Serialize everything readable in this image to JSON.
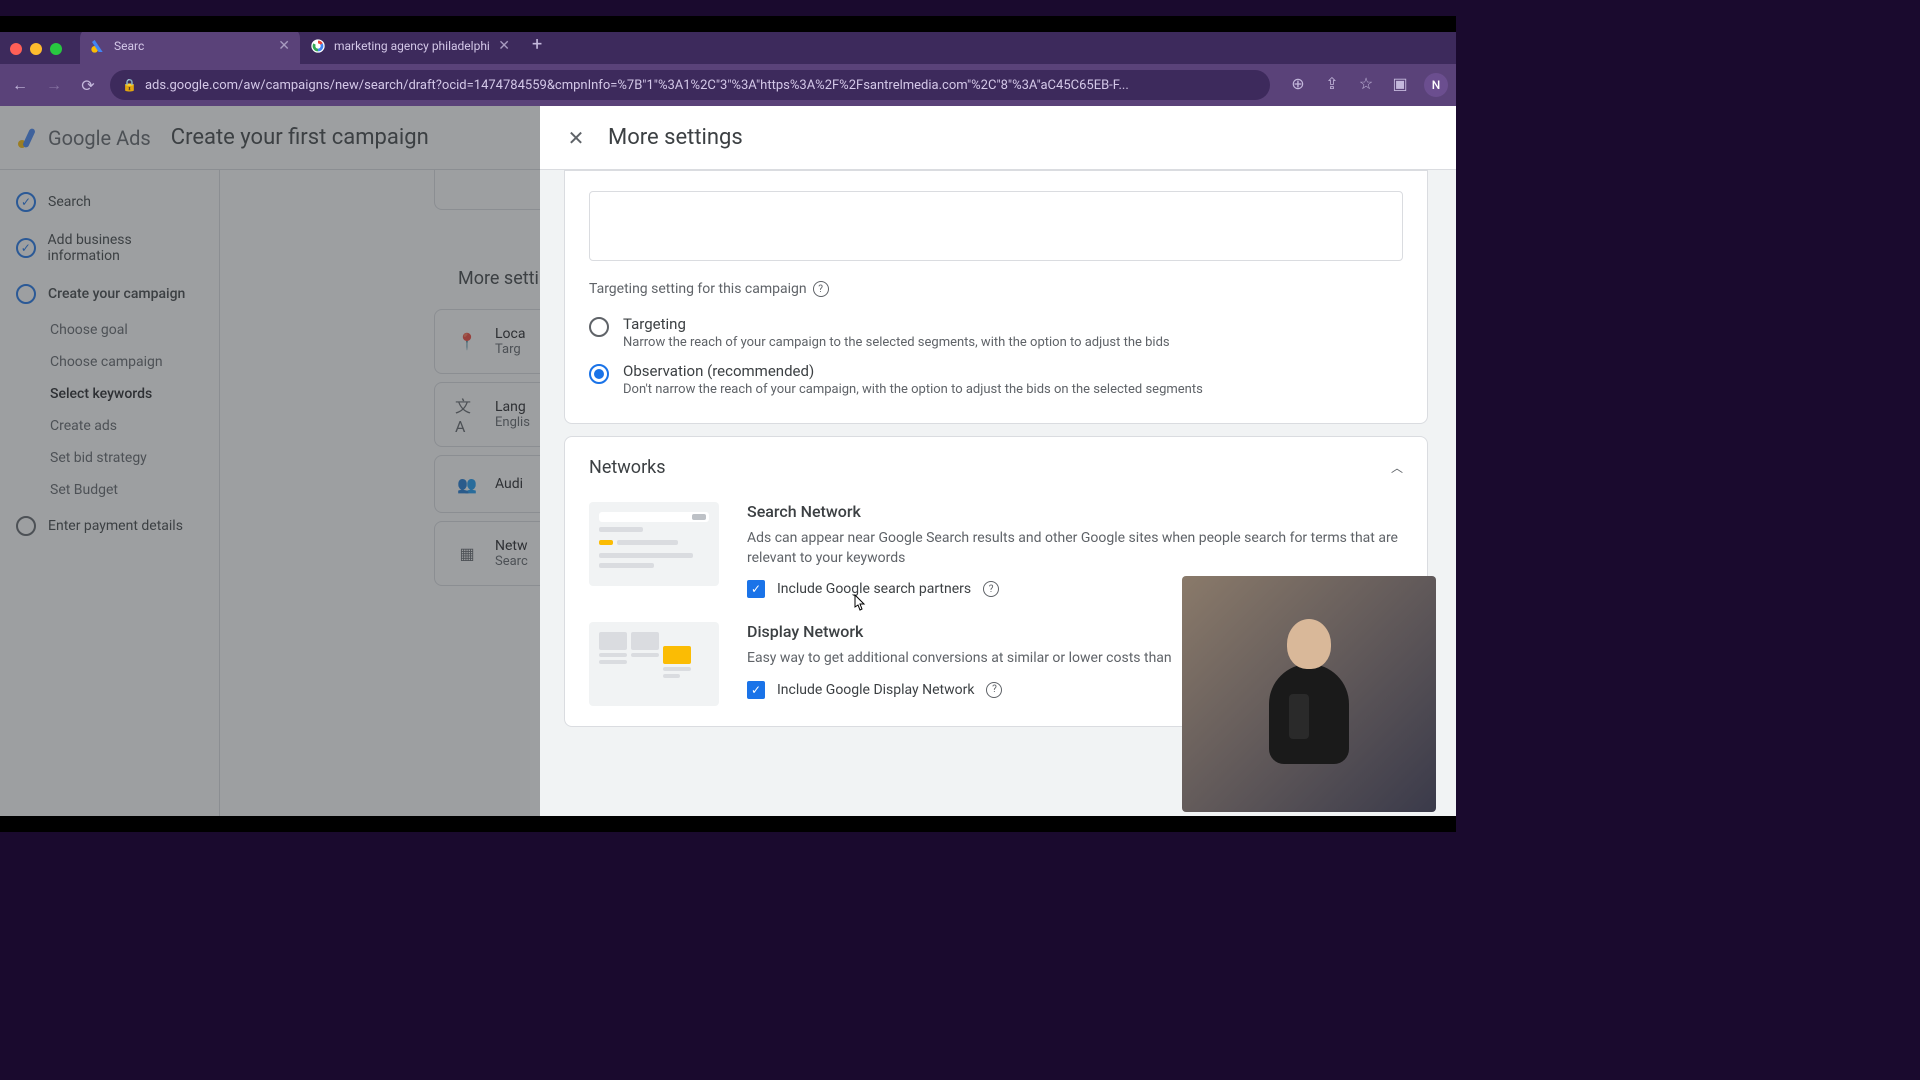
{
  "browser": {
    "tabs": [
      {
        "title": "Searc",
        "favicon": "ads"
      },
      {
        "title": "marketing agency philadelphi",
        "favicon": "google"
      }
    ],
    "url": "ads.google.com/aw/campaigns/new/search/draft?ocid=1474784559&cmpnInfo=%7B\"1\"%3A1%2C\"3\"%3A\"https%3A%2F%2Fsantrelmedia.com\"%2C\"8\"%3A\"aC45C65EB-F...",
    "profile_initial": "N"
  },
  "app": {
    "logo_text": "Google Ads",
    "header_title": "Create your first campaign"
  },
  "sidebar": {
    "items": [
      {
        "label": "Search",
        "state": "done"
      },
      {
        "label": "Add business information",
        "state": "done"
      },
      {
        "label": "Create your campaign",
        "state": "current"
      },
      {
        "label": "Enter payment details",
        "state": "pending"
      }
    ],
    "sub_items": [
      {
        "label": "Choose goal"
      },
      {
        "label": "Choose campaign"
      },
      {
        "label": "Select keywords",
        "active": true
      },
      {
        "label": "Create ads"
      },
      {
        "label": "Set bid strategy"
      },
      {
        "label": "Set Budget"
      }
    ]
  },
  "background_cards": {
    "section_label": "More setti",
    "location": {
      "label": "Loca",
      "sub": "Targ"
    },
    "language": {
      "label": "Lang",
      "sub": "Englis"
    },
    "audience": {
      "label": "Audi"
    },
    "network": {
      "label": "Netw",
      "sub": "Searc"
    }
  },
  "panel": {
    "title": "More settings",
    "targeting": {
      "heading": "Targeting setting for this campaign",
      "options": [
        {
          "label": "Targeting",
          "desc": "Narrow the reach of your campaign to the selected segments, with the option to adjust the bids",
          "selected": false
        },
        {
          "label": "Observation (recommended)",
          "desc": "Don't narrow the reach of your campaign, with the option to adjust the bids on the selected segments",
          "selected": true
        }
      ]
    },
    "networks": {
      "title": "Networks",
      "search": {
        "title": "Search Network",
        "desc": "Ads can appear near Google Search results and other Google sites when people search for terms that are relevant to your keywords",
        "checkbox_label": "Include Google search partners",
        "checked": true
      },
      "display": {
        "title": "Display Network",
        "desc": "Easy way to get additional conversions at similar or lower costs than",
        "checkbox_label": "Include Google Display Network",
        "checked": true
      }
    }
  }
}
